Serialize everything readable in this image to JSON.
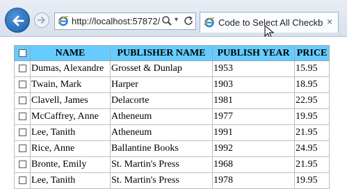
{
  "browser": {
    "address": "http://localhost:57872/",
    "tab_title": "Code to Select All Checkbo...",
    "tab_close": "×"
  },
  "table": {
    "headers": [
      "NAME",
      "PUBLISHER NAME",
      "PUBLISH YEAR",
      "PRICE"
    ],
    "rows": [
      [
        "Dumas, Alexandre",
        "Grosset & Dunlap",
        "1953",
        "15.95"
      ],
      [
        "Twain, Mark",
        "Harper",
        "1903",
        "18.95"
      ],
      [
        "Clavell, James",
        "Delacorte",
        "1981",
        "22.95"
      ],
      [
        "McCaffrey, Anne",
        "Atheneum",
        "1977",
        "19.95"
      ],
      [
        "Lee, Tanith",
        "Atheneum",
        "1991",
        "21.95"
      ],
      [
        "Rice, Anne",
        "Ballantine Books",
        "1992",
        "24.95"
      ],
      [
        "Bronte, Emily",
        "St. Martin's Press",
        "1968",
        "21.95"
      ],
      [
        "Lee, Tanith",
        "St. Martin's Press",
        "1978",
        "19.95"
      ]
    ]
  },
  "colors": {
    "header_bg": "#66ccff",
    "back_button": "#1d5ea8"
  },
  "icons": [
    "back-arrow-icon",
    "forward-arrow-icon",
    "ie-icon",
    "search-icon",
    "dropdown-icon",
    "refresh-icon",
    "close-icon",
    "mouse-cursor-icon"
  ]
}
